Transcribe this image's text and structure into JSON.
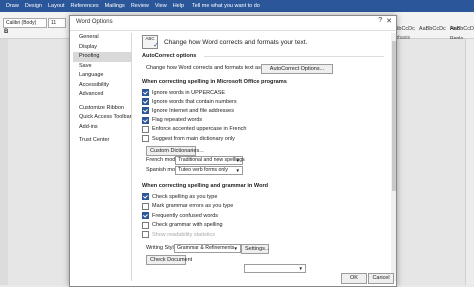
{
  "app": {
    "ribbon_tabs": [
      "Draw",
      "Design",
      "Layout",
      "References",
      "Mailings",
      "Review",
      "View",
      "Help"
    ],
    "tell_me": "Tell me what you want to do",
    "font_name": "Calibri (Body)",
    "font_size": "11",
    "bold_label": "B",
    "styles": [
      "AaBbCcDc",
      "AaBbCcDc",
      "AaBbCcD"
    ],
    "emphasis_label": "Emphasis",
    "find_panel": [
      "Find",
      "Repla",
      "Selec"
    ]
  },
  "dialog": {
    "title": "Word Options",
    "help_glyph": "?",
    "close_glyph": "✕",
    "sidebar": [
      {
        "label": "General",
        "active": false
      },
      {
        "label": "Display",
        "active": false
      },
      {
        "label": "Proofing",
        "active": true
      },
      {
        "label": "Save",
        "active": false
      },
      {
        "label": "Language",
        "active": false
      },
      {
        "label": "Accessibility",
        "active": false
      },
      {
        "label": "Advanced",
        "active": false
      },
      {
        "label": "Customize Ribbon",
        "active": false
      },
      {
        "label": "Quick Access Toolbar",
        "active": false
      },
      {
        "label": "Add-ins",
        "active": false
      },
      {
        "label": "Trust Center",
        "active": false
      }
    ],
    "header_text": "Change how Word corrects and formats your text.",
    "abc_icon_text": "ABC",
    "autocorrect": {
      "title": "AutoCorrect options",
      "description": "Change how Word corrects and formats text as you type:",
      "button": "AutoCorrect Options..."
    },
    "office": {
      "title": "When correcting spelling in Microsoft Office programs",
      "options": [
        {
          "label": "Ignore words in UPPERCASE",
          "checked": true
        },
        {
          "label": "Ignore words that contain numbers",
          "checked": true
        },
        {
          "label": "Ignore Internet and file addresses",
          "checked": true
        },
        {
          "label": "Flag repeated words",
          "checked": true
        },
        {
          "label": "Enforce accented uppercase in French",
          "checked": false
        },
        {
          "label": "Suggest from main dictionary only",
          "checked": false
        }
      ],
      "custom_dictionaries": "Custom Dictionaries...",
      "french_label": "French modes:",
      "french_value": "Traditional and new spellings",
      "spanish_label": "Spanish modes:",
      "spanish_value": "Tuteo verb forms only"
    },
    "word": {
      "title": "When correcting spelling and grammar in Word",
      "options": [
        {
          "label": "Check spelling as you type",
          "checked": true,
          "disabled": false
        },
        {
          "label": "Mark grammar errors as you type",
          "checked": false,
          "disabled": false
        },
        {
          "label": "Frequently confused words",
          "checked": true,
          "disabled": false
        },
        {
          "label": "Check grammar with spelling",
          "checked": false,
          "disabled": false
        },
        {
          "label": "Show readability statistics",
          "checked": false,
          "disabled": true
        }
      ],
      "writing_style_label": "Writing Style:",
      "writing_style_value": "Grammar & Refinements",
      "settings_button": "Settings...",
      "check_document_button": "Check Document"
    },
    "ok": "OK",
    "cancel": "Cancel"
  }
}
